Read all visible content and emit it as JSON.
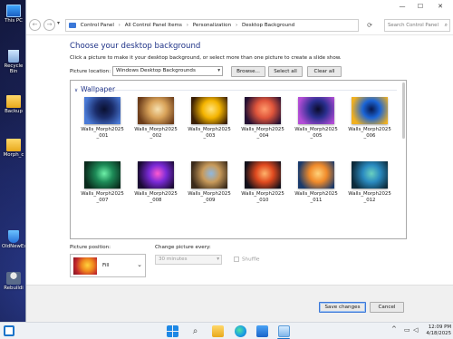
{
  "desktop": {
    "icons": [
      {
        "label": "This PC",
        "icon": "computer-icon"
      },
      {
        "label": "Recycle Bin",
        "icon": "recycle-bin-icon"
      },
      {
        "label": "Backup",
        "icon": "folder-icon"
      },
      {
        "label": "Morph_c",
        "icon": "folder-icon"
      },
      {
        "label": "OldNewEx",
        "icon": "shield-icon"
      },
      {
        "label": "Rebuildi",
        "icon": "person-icon"
      }
    ]
  },
  "window": {
    "caption": {
      "minimize": "—",
      "maximize": "☐",
      "close": "✕"
    },
    "nav": {
      "back": "←",
      "forward": "→",
      "dropdown": "▾"
    },
    "breadcrumb": [
      "Control Panel",
      "All Control Panel Items",
      "Personalization",
      "Desktop Background"
    ],
    "breadcrumb_sep": "›",
    "refresh": "⟳",
    "search": {
      "placeholder": "Search Control Panel",
      "icon": "⌕"
    },
    "heading": "Choose your desktop background",
    "instructions": "Click a picture to make it your desktop background, or select more than one picture to create a slide show.",
    "picture_location": {
      "label": "Picture location:",
      "value": "Windows Desktop Backgrounds",
      "caret": "▾",
      "browse": "Browse...",
      "select_all": "Select all",
      "clear_all": "Clear all"
    },
    "gallery": {
      "group": "Wallpaper",
      "chevron": "∨",
      "thumbnails": [
        {
          "line1": "Walls_Morph2025",
          "line2": "_001",
          "colors": [
            "#1b2d6b",
            "#4a7ad6",
            "#0a1030"
          ]
        },
        {
          "line1": "Walls_Morph2025",
          "line2": "_002",
          "colors": [
            "#d9a35a",
            "#6b3c1a",
            "#f5e0b0"
          ]
        },
        {
          "line1": "Walls_Morph2025",
          "line2": "_003",
          "colors": [
            "#f4b400",
            "#3a1f05",
            "#ffe27a"
          ]
        },
        {
          "line1": "Walls_Morph2025",
          "line2": "_004",
          "colors": [
            "#e0553b",
            "#241033",
            "#ff9a6b"
          ]
        },
        {
          "line1": "Walls_Morph2025",
          "line2": "_005",
          "colors": [
            "#2a2f8f",
            "#b34dd6",
            "#0b0b2a"
          ]
        },
        {
          "line1": "Walls_Morph2025",
          "line2": "_006",
          "colors": [
            "#1b65d6",
            "#f0b020",
            "#08184d"
          ]
        },
        {
          "line1": "Walls_Morph2025",
          "line2": "_007",
          "colors": [
            "#1d8a57",
            "#0a2a1c",
            "#6ef0a8"
          ]
        },
        {
          "line1": "Walls_Morph2025",
          "line2": "_008",
          "colors": [
            "#7a2ad6",
            "#1a0a33",
            "#ff5ad0"
          ]
        },
        {
          "line1": "Walls_Morph2025",
          "line2": "_009",
          "colors": [
            "#c89a5a",
            "#3a2a1a",
            "#8fb8e0"
          ]
        },
        {
          "line1": "Walls_Morph2025",
          "line2": "_010",
          "colors": [
            "#e04a1f",
            "#12101a",
            "#ffb36b"
          ]
        },
        {
          "line1": "Walls_Morph2025",
          "line2": "_011",
          "colors": [
            "#f08a2a",
            "#1a3a6b",
            "#ffd27a"
          ]
        },
        {
          "line1": "Walls_Morph2025",
          "line2": "_012",
          "colors": [
            "#2a8ac0",
            "#0c2a3a",
            "#6ad0c0"
          ]
        }
      ]
    },
    "picture_position": {
      "label": "Picture position:",
      "value": "Fill",
      "caret": "⌄"
    },
    "change_picture": {
      "label": "Change picture every:",
      "value": "30 minutes",
      "caret": "▾"
    },
    "shuffle": "Shuffle",
    "save": "Save changes",
    "cancel": "Cancel"
  },
  "taskbar": {
    "search_glyph": "⌕",
    "tray": {
      "chevron": "^",
      "network": "▭",
      "volume": "◁"
    },
    "time": "12:09 PM",
    "date": "4/18/2025"
  }
}
